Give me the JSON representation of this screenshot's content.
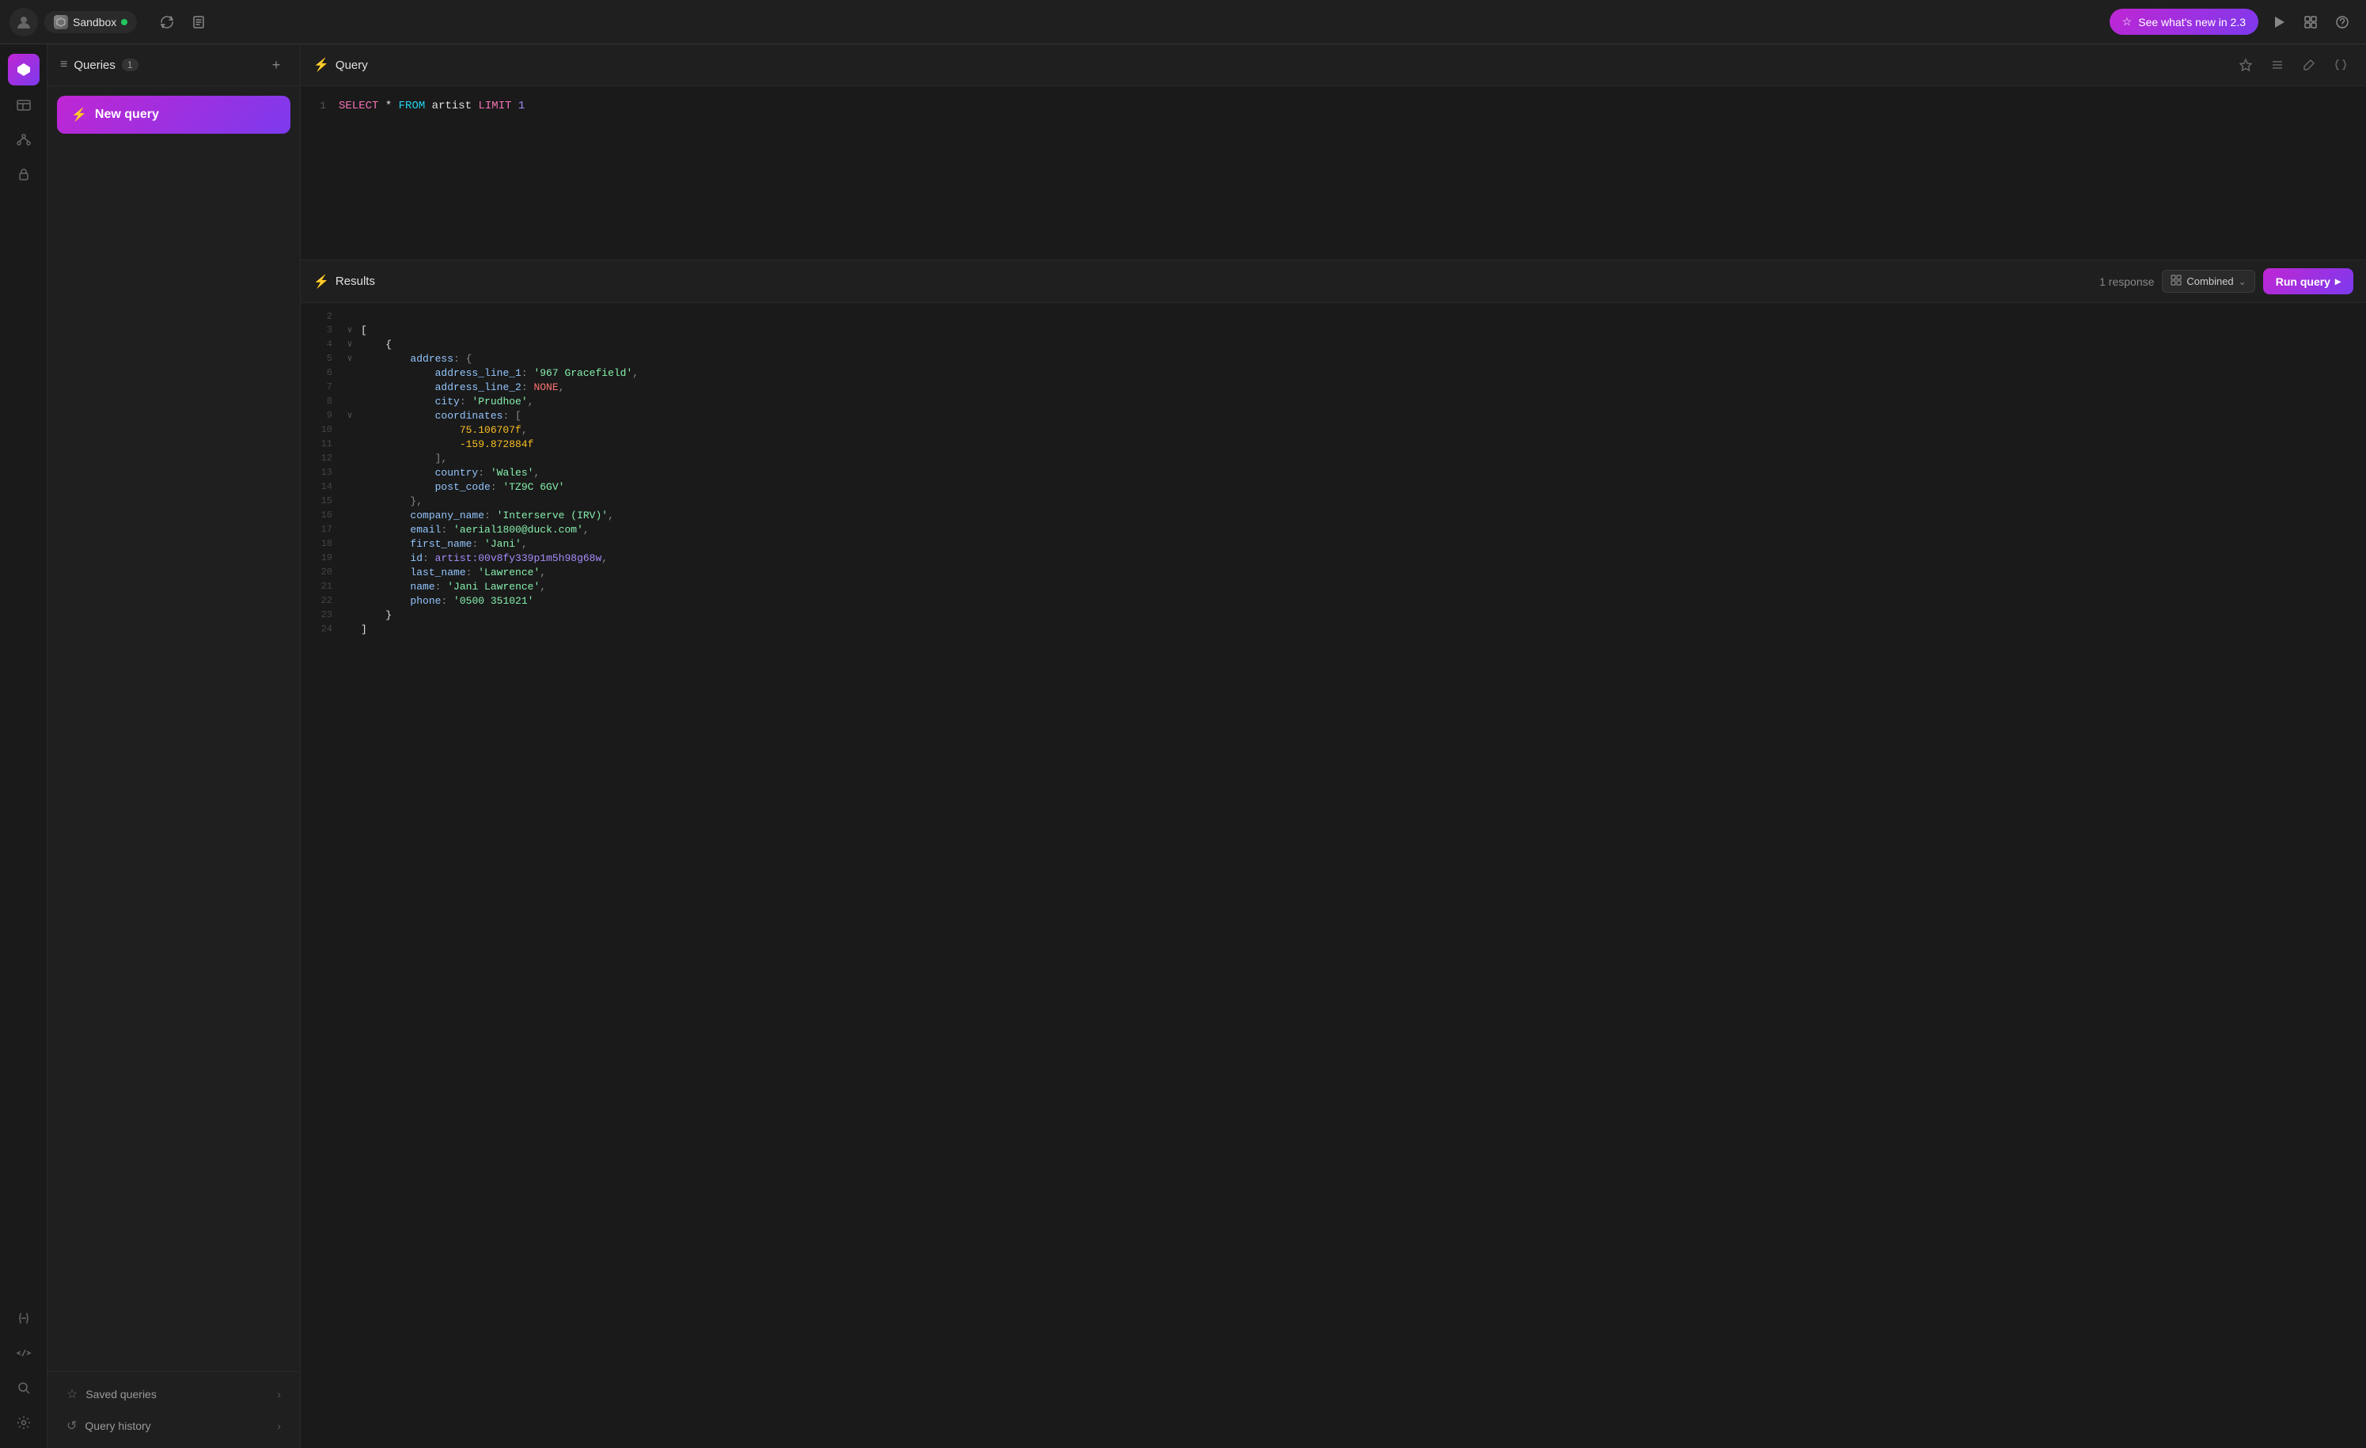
{
  "topbar": {
    "avatar_icon": "👤",
    "workspace_icon": "⬡",
    "workspace_name": "Sandbox",
    "online_status": "online",
    "sync_icon": "↻",
    "doc_icon": "📄",
    "whats_new_label": "See what's new in 2.3",
    "play_icon": "▶",
    "grid_icon": "▦",
    "help_icon": "?"
  },
  "sidebar": {
    "menu_icon": "≡",
    "title": "Queries",
    "count": "1",
    "add_icon": "+",
    "new_query_icon": "⚡",
    "new_query_label": "New query",
    "saved_queries_icon": "☆",
    "saved_queries_label": "Saved queries",
    "query_history_icon": "↺",
    "query_history_label": "Query history"
  },
  "query_panel": {
    "query_icon": "⚡",
    "title": "Query",
    "star_icon": "☆",
    "list_icon": "≡",
    "pen_icon": "✎",
    "braces_icon": "{}",
    "code_lines": [
      {
        "num": "1",
        "content_html": "<span class='kw-select'>SELECT</span> <span class='kw-star'>*</span> <span class='kw-from'>FROM</span> <span class='kw-ident'>artist</span> <span class='kw-limit'>LIMIT</span> <span class='kw-num'>1</span>"
      }
    ]
  },
  "results_panel": {
    "results_icon": "⚡",
    "title": "Results",
    "response_count": "1 response",
    "combined_icon": "▦",
    "combined_label": "Combined",
    "chevron_icon": "⌄",
    "run_query_label": "Run query",
    "run_icon": "▸",
    "result_lines": [
      {
        "num": "2",
        "toggle": "",
        "content_html": ""
      },
      {
        "num": "3",
        "toggle": "∨",
        "content_html": "<span class='json-bracket'>[</span>"
      },
      {
        "num": "4",
        "toggle": "∨",
        "content_html": "&nbsp;&nbsp;&nbsp;&nbsp;<span class='json-bracket'>{</span>"
      },
      {
        "num": "5",
        "toggle": "∨",
        "content_html": "&nbsp;&nbsp;&nbsp;&nbsp;&nbsp;&nbsp;&nbsp;&nbsp;<span class='json-key'>address</span><span class='json-punct'>: {</span>"
      },
      {
        "num": "6",
        "toggle": "",
        "content_html": "&nbsp;&nbsp;&nbsp;&nbsp;&nbsp;&nbsp;&nbsp;&nbsp;&nbsp;&nbsp;&nbsp;&nbsp;<span class='json-key'>address_line_1</span><span class='json-punct'>: </span><span class='json-str'>'967 Gracefield'</span><span class='json-punct'>,</span>"
      },
      {
        "num": "7",
        "toggle": "",
        "content_html": "&nbsp;&nbsp;&nbsp;&nbsp;&nbsp;&nbsp;&nbsp;&nbsp;&nbsp;&nbsp;&nbsp;&nbsp;<span class='json-key'>address_line_2</span><span class='json-punct'>: </span><span class='json-null'>NONE</span><span class='json-punct'>,</span>"
      },
      {
        "num": "8",
        "toggle": "",
        "content_html": "&nbsp;&nbsp;&nbsp;&nbsp;&nbsp;&nbsp;&nbsp;&nbsp;&nbsp;&nbsp;&nbsp;&nbsp;<span class='json-key'>city</span><span class='json-punct'>: </span><span class='json-str'>'Prudhoe'</span><span class='json-punct'>,</span>"
      },
      {
        "num": "9",
        "toggle": "∨",
        "content_html": "&nbsp;&nbsp;&nbsp;&nbsp;&nbsp;&nbsp;&nbsp;&nbsp;&nbsp;&nbsp;&nbsp;&nbsp;<span class='json-key'>coordinates</span><span class='json-punct'>: [</span>"
      },
      {
        "num": "10",
        "toggle": "",
        "content_html": "&nbsp;&nbsp;&nbsp;&nbsp;&nbsp;&nbsp;&nbsp;&nbsp;&nbsp;&nbsp;&nbsp;&nbsp;&nbsp;&nbsp;&nbsp;&nbsp;<span class='json-num'>75.106707f</span><span class='json-punct'>,</span>"
      },
      {
        "num": "11",
        "toggle": "",
        "content_html": "&nbsp;&nbsp;&nbsp;&nbsp;&nbsp;&nbsp;&nbsp;&nbsp;&nbsp;&nbsp;&nbsp;&nbsp;&nbsp;&nbsp;&nbsp;&nbsp;<span class='json-num'>-159.872884f</span>"
      },
      {
        "num": "12",
        "toggle": "",
        "content_html": "&nbsp;&nbsp;&nbsp;&nbsp;&nbsp;&nbsp;&nbsp;&nbsp;&nbsp;&nbsp;&nbsp;&nbsp;<span class='json-punct'>],</span>"
      },
      {
        "num": "13",
        "toggle": "",
        "content_html": "&nbsp;&nbsp;&nbsp;&nbsp;&nbsp;&nbsp;&nbsp;&nbsp;&nbsp;&nbsp;&nbsp;&nbsp;<span class='json-key'>country</span><span class='json-punct'>: </span><span class='json-str'>'Wales'</span><span class='json-punct'>,</span>"
      },
      {
        "num": "14",
        "toggle": "",
        "content_html": "&nbsp;&nbsp;&nbsp;&nbsp;&nbsp;&nbsp;&nbsp;&nbsp;&nbsp;&nbsp;&nbsp;&nbsp;<span class='json-key'>post_code</span><span class='json-punct'>: </span><span class='json-str'>'TZ9C 6GV'</span>"
      },
      {
        "num": "15",
        "toggle": "",
        "content_html": "&nbsp;&nbsp;&nbsp;&nbsp;&nbsp;&nbsp;&nbsp;&nbsp;<span class='json-punct'>},</span>"
      },
      {
        "num": "16",
        "toggle": "",
        "content_html": "&nbsp;&nbsp;&nbsp;&nbsp;&nbsp;&nbsp;&nbsp;&nbsp;<span class='json-key'>company_name</span><span class='json-punct'>: </span><span class='json-str'>'Interserve (IRV)'</span><span class='json-punct'>,</span>"
      },
      {
        "num": "17",
        "toggle": "",
        "content_html": "&nbsp;&nbsp;&nbsp;&nbsp;&nbsp;&nbsp;&nbsp;&nbsp;<span class='json-key'>email</span><span class='json-punct'>: </span><span class='json-str'>'aerial1800@duck.com'</span><span class='json-punct'>,</span>"
      },
      {
        "num": "18",
        "toggle": "",
        "content_html": "&nbsp;&nbsp;&nbsp;&nbsp;&nbsp;&nbsp;&nbsp;&nbsp;<span class='json-key'>first_name</span><span class='json-punct'>: </span><span class='json-str'>'Jani'</span><span class='json-punct'>,</span>"
      },
      {
        "num": "19",
        "toggle": "",
        "content_html": "&nbsp;&nbsp;&nbsp;&nbsp;&nbsp;&nbsp;&nbsp;&nbsp;<span class='json-key'>id</span><span class='json-punct'>: </span><span class='json-id'>artist:00v8fy339p1m5h98g68w</span><span class='json-punct'>,</span>"
      },
      {
        "num": "20",
        "toggle": "",
        "content_html": "&nbsp;&nbsp;&nbsp;&nbsp;&nbsp;&nbsp;&nbsp;&nbsp;<span class='json-key'>last_name</span><span class='json-punct'>: </span><span class='json-str'>'Lawrence'</span><span class='json-punct'>,</span>"
      },
      {
        "num": "21",
        "toggle": "",
        "content_html": "&nbsp;&nbsp;&nbsp;&nbsp;&nbsp;&nbsp;&nbsp;&nbsp;<span class='json-key'>name</span><span class='json-punct'>: </span><span class='json-str'>'Jani Lawrence'</span><span class='json-punct'>,</span>"
      },
      {
        "num": "22",
        "toggle": "",
        "content_html": "&nbsp;&nbsp;&nbsp;&nbsp;&nbsp;&nbsp;&nbsp;&nbsp;<span class='json-key'>phone</span><span class='json-punct'>: </span><span class='json-str'>'0500 351021'</span>"
      },
      {
        "num": "23",
        "toggle": "",
        "content_html": "&nbsp;&nbsp;&nbsp;&nbsp;<span class='json-bracket'>}</span>"
      },
      {
        "num": "24",
        "toggle": "",
        "content_html": "<span class='json-bracket'>]</span>"
      }
    ]
  }
}
